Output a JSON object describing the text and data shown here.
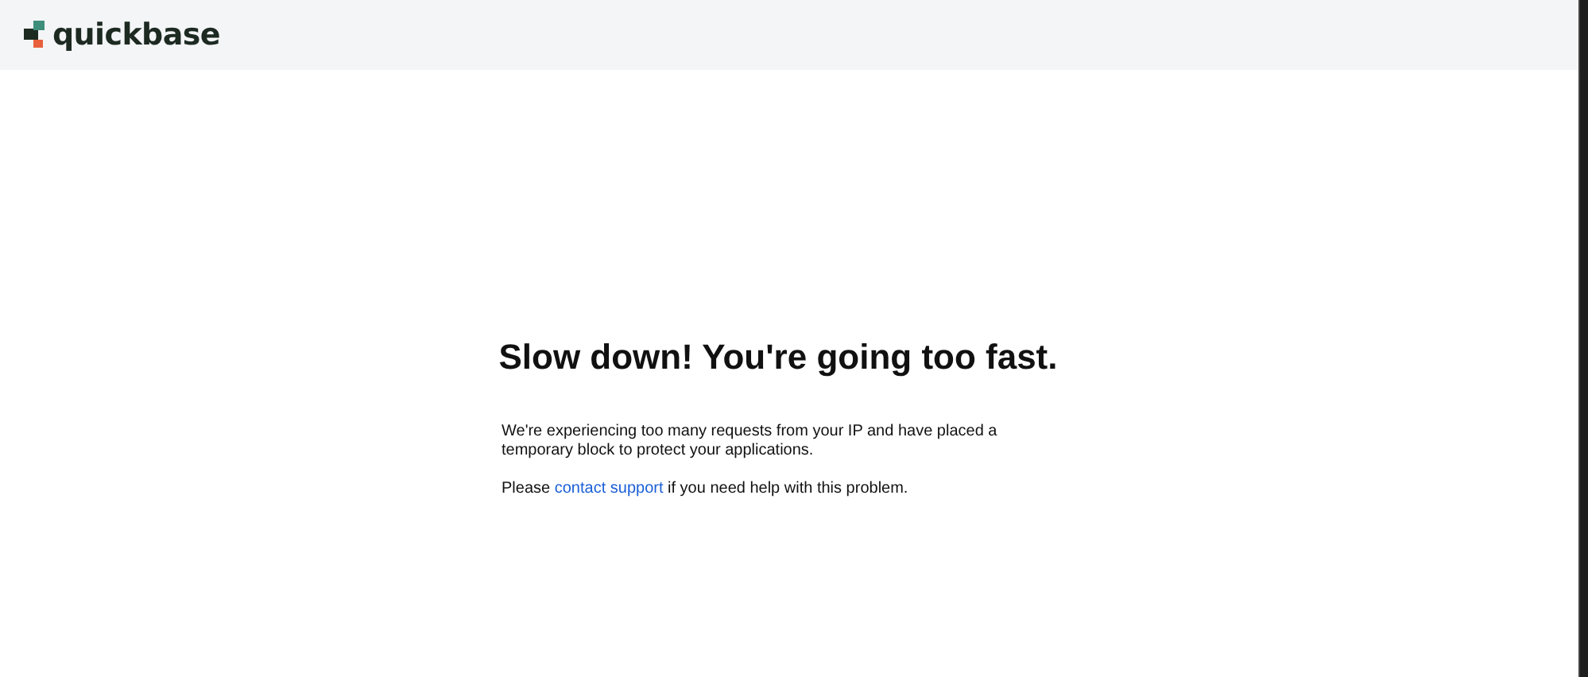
{
  "header": {
    "logo_text": "quickbase"
  },
  "message": {
    "title": "Slow down! You're going too fast.",
    "body": "We're experiencing too many requests from your IP and have placed a temporary block to protect your applications.",
    "help_before": "Please ",
    "help_link": "contact support",
    "help_after": " if you need help with this problem."
  }
}
